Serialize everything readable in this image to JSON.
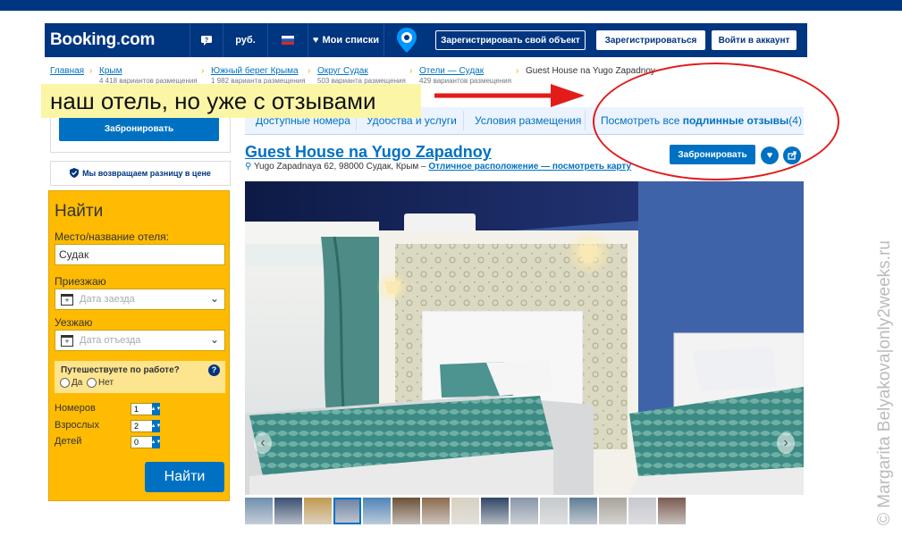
{
  "header": {
    "logo_main": "Booking",
    "logo_dot": ".",
    "logo_tld": "com",
    "currency": "руб.",
    "wishlists": "Мои списки",
    "register_property": "Зарегистрировать свой объект",
    "register": "Зарегистрироваться",
    "sign_in": "Войти в аккаунт"
  },
  "breadcrumbs": [
    {
      "label": "Главная",
      "sub": ""
    },
    {
      "label": "Крым",
      "sub": "4 418 вариантов размещения"
    },
    {
      "label": "Южный берег Крыма",
      "sub": "1 982 варианта размещения"
    },
    {
      "label": "Округ Судак",
      "sub": "503 варианта размещения"
    },
    {
      "label": "Отели — Судак",
      "sub": "429 вариантов размещения"
    }
  ],
  "breadcrumb_current": "Guest House na Yugo Zapadnoy",
  "breadcrumb_separator": "›",
  "annotation": "наш отель, но уже с отзывами",
  "tabs": {
    "rooms": "Доступные номера",
    "facilities": "Удобства и услуги",
    "policies": "Условия размещения",
    "reviews_prefix": "Посмотреть все ",
    "reviews_bold": "подлинные отзывы",
    "reviews_count": " (4)"
  },
  "sidebar": {
    "book_button": "Забронировать",
    "price_match": "Мы возвращаем разницу в цене"
  },
  "search": {
    "title": "Найти",
    "destination_label": "Место/название отеля:",
    "destination_value": "Судак",
    "checkin_label": "Приезжаю",
    "checkin_placeholder": "Дата заезда",
    "checkout_label": "Уезжаю",
    "checkout_placeholder": "Дата отъезда",
    "work_trip_question": "Путешествуете по работе?",
    "yes": "Да",
    "no": "Нет",
    "rooms_label": "Номеров",
    "rooms_value": "1",
    "adults_label": "Взрослых",
    "adults_value": "2",
    "children_label": "Детей",
    "children_value": "0",
    "search_button": "Найти"
  },
  "hotel": {
    "name": "Guest House na Yugo Zapadnoy",
    "address": "Yugo Zapadnaya 62, 98000 Судак, Крым –",
    "location_link": "Отличное расположение — посмотреть карту",
    "book_button": "Забронировать"
  },
  "gallery": {
    "prev": "‹",
    "next": "›",
    "thumb_colors": [
      "#6f8fae",
      "#3a4f72",
      "#c29a52",
      "#6a7fa0",
      "#4f84b8",
      "#6b5037",
      "#8a6b4d",
      "#d7d0c1",
      "#2f4566",
      "#8896a8",
      "#c5c9cc",
      "#5f7d95",
      "#a8a39a",
      "#c7c7d0",
      "#7a5a50"
    ]
  },
  "watermark": "© Margarita Belyakova|only2weeks.ru",
  "colors": {
    "brand_blue": "#003580",
    "link_blue": "#0071c2",
    "search_yellow": "#febb02",
    "annotation_red": "#e31b1b"
  }
}
